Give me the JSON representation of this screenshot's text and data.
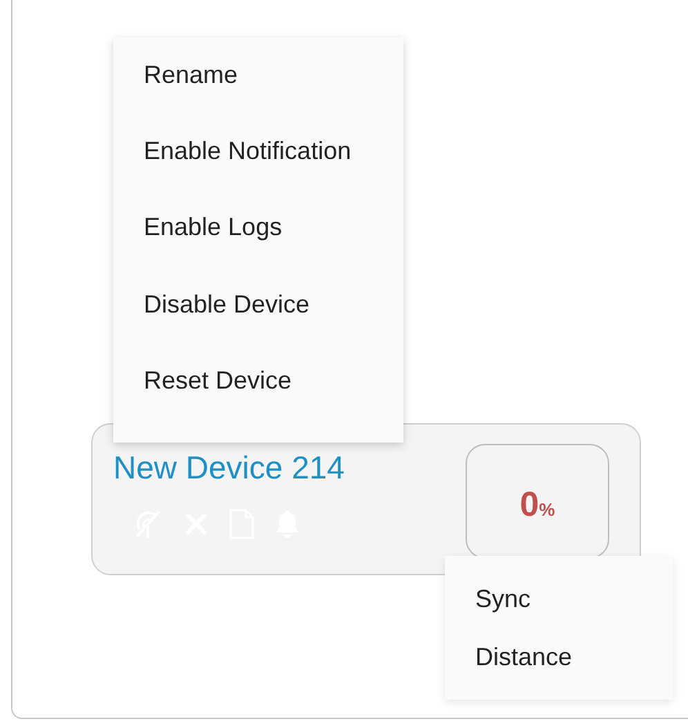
{
  "context_menu": {
    "items": [
      {
        "label": "Rename"
      },
      {
        "label": "Enable Notification"
      },
      {
        "label": "Enable Logs"
      },
      {
        "label": "Disable Device"
      },
      {
        "label": "Reset Device"
      }
    ]
  },
  "device_card": {
    "name": "New Device 214",
    "battery": {
      "value": "0",
      "unit": "%"
    }
  },
  "secondary_menu": {
    "items": [
      {
        "label": "Sync"
      },
      {
        "label": "Distance"
      }
    ]
  }
}
